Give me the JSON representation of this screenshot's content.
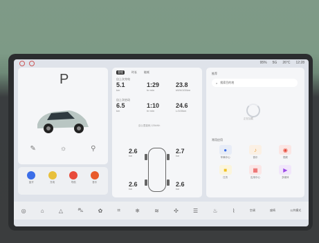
{
  "status": {
    "battery": "95%",
    "signal": "5G",
    "temperature": "26°C",
    "time": "12:28"
  },
  "gear": {
    "current": "P"
  },
  "drive_stats": {
    "tabs": [
      "里程",
      "时长",
      "能耗"
    ],
    "section1": "自上次充电",
    "section2": "自上次启动",
    "row1": {
      "distance": "5.1",
      "distance_unit": "km",
      "duration": "1:29",
      "duration_unit": "hr:min",
      "consumption": "23.8",
      "consumption_unit": "kWh/100km"
    },
    "row2": {
      "distance": "6.5",
      "distance_unit": "km",
      "duration": "1:10",
      "duration_unit": "hr:min",
      "consumption": "24.6",
      "consumption_unit": "L/100km"
    },
    "note": "百公里能耗 125kWh"
  },
  "tires": {
    "fl": "2.6",
    "fr": "2.7",
    "rl": "2.6",
    "rr": "2.6",
    "unit": "bar"
  },
  "right_panel": {
    "title": "推荐",
    "search_placeholder": "搜索目的地",
    "loading": "正在加载",
    "section": "常用应用",
    "apps": [
      {
        "label": "车辆中心",
        "color": "#3b6ee8",
        "icon": "car-icon"
      },
      {
        "label": "音乐",
        "color": "#e8a03b",
        "icon": "music-icon"
      },
      {
        "label": "视频",
        "color": "#e84b3b",
        "icon": "video-icon"
      },
      {
        "label": "日历",
        "color": "#f0c020",
        "icon": "calendar-icon"
      },
      {
        "label": "应用中心",
        "color": "#e85050",
        "icon": "apps-icon"
      },
      {
        "label": "多媒体",
        "color": "#9b4be8",
        "icon": "media-icon"
      }
    ]
  },
  "left_apps": [
    {
      "label": "蓝牙",
      "color": "#3b6ee8"
    },
    {
      "label": "充电",
      "color": "#e8c03b"
    },
    {
      "label": "导航",
      "color": "#e84b3b"
    },
    {
      "label": "音乐",
      "color": "#e85a2b"
    }
  ],
  "dock": {
    "labels": [
      "空调",
      "座椅",
      "公共模式"
    ]
  }
}
